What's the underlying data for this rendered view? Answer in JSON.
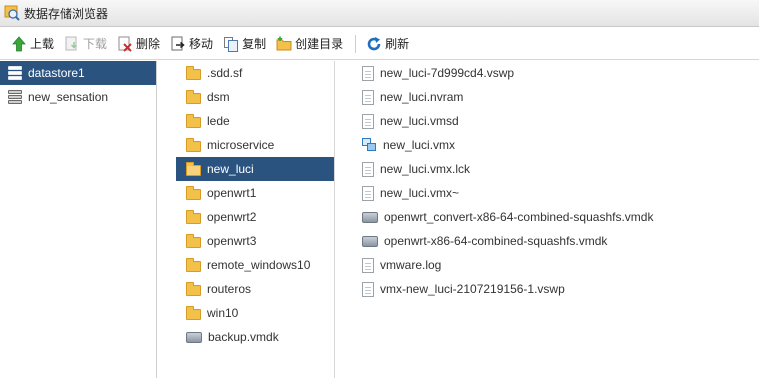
{
  "window": {
    "title": "数据存储浏览器"
  },
  "toolbar": {
    "upload": "上载",
    "download": "下载",
    "delete": "删除",
    "move": "移动",
    "copy": "复制",
    "mkdir": "创建目录",
    "refresh": "刷新"
  },
  "datastores": [
    {
      "label": "datastore1",
      "selected": true
    },
    {
      "label": "new_sensation",
      "selected": false
    }
  ],
  "folders": [
    {
      "label": ".sdd.sf",
      "icon": "folder"
    },
    {
      "label": "dsm",
      "icon": "folder"
    },
    {
      "label": "lede",
      "icon": "folder"
    },
    {
      "label": "microservice",
      "icon": "folder"
    },
    {
      "label": "new_luci",
      "icon": "folder",
      "selected": true
    },
    {
      "label": "openwrt1",
      "icon": "folder"
    },
    {
      "label": "openwrt2",
      "icon": "folder"
    },
    {
      "label": "openwrt3",
      "icon": "folder"
    },
    {
      "label": "remote_windows10",
      "icon": "folder"
    },
    {
      "label": "routeros",
      "icon": "folder"
    },
    {
      "label": "win10",
      "icon": "folder"
    },
    {
      "label": "backup.vmdk",
      "icon": "disk"
    }
  ],
  "files": [
    {
      "label": "new_luci-7d999cd4.vswp",
      "icon": "doc"
    },
    {
      "label": "new_luci.nvram",
      "icon": "doc"
    },
    {
      "label": "new_luci.vmsd",
      "icon": "doc"
    },
    {
      "label": "new_luci.vmx",
      "icon": "vmx"
    },
    {
      "label": "new_luci.vmx.lck",
      "icon": "doc"
    },
    {
      "label": "new_luci.vmx~",
      "icon": "doc"
    },
    {
      "label": "openwrt_convert-x86-64-combined-squashfs.vmdk",
      "icon": "disk"
    },
    {
      "label": "openwrt-x86-64-combined-squashfs.vmdk",
      "icon": "disk"
    },
    {
      "label": "vmware.log",
      "icon": "doc"
    },
    {
      "label": "vmx-new_luci-2107219156-1.vswp",
      "icon": "doc"
    }
  ],
  "colors": {
    "selection": "#2b5380",
    "upload_arrow": "#3aa63a",
    "refresh": "#1f6fc0"
  }
}
